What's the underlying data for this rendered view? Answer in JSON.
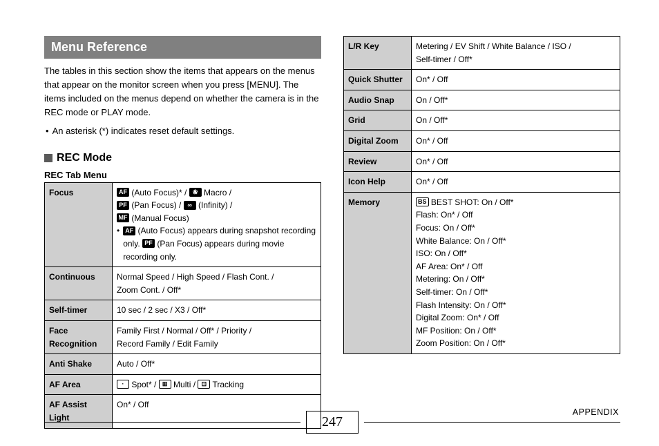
{
  "title": "Menu Reference",
  "intro": "The tables in this section show the items that appears on the menus that appear on the monitor screen when you press [MENU]. The items included on the menus depend on whether the camera is in the REC mode or PLAY mode.",
  "intro_bullet": "An asterisk (*) indicates reset default settings.",
  "rec_mode_heading": "REC Mode",
  "rec_tab_heading": "REC Tab Menu",
  "left_table": [
    {
      "key": "Focus",
      "lines": [
        {
          "parts": [
            {
              "t": "icon",
              "v": "AF"
            },
            {
              "t": "text",
              "v": " (Auto Focus)* / "
            },
            {
              "t": "icon",
              "v": "❀"
            },
            {
              "t": "text",
              "v": " Macro /"
            }
          ]
        },
        {
          "parts": [
            {
              "t": "icon",
              "v": "PF"
            },
            {
              "t": "text",
              "v": " (Pan Focus) / "
            },
            {
              "t": "icon",
              "v": "∞"
            },
            {
              "t": "text",
              "v": " (Infinity) /"
            }
          ]
        },
        {
          "parts": [
            {
              "t": "icon",
              "v": "MF"
            },
            {
              "t": "text",
              "v": " (Manual Focus)"
            }
          ]
        },
        {
          "sub": true,
          "parts": [
            {
              "t": "icon",
              "v": "AF"
            },
            {
              "t": "text",
              "v": " (Auto Focus) appears during snapshot recording only. "
            },
            {
              "t": "icon",
              "v": "PF"
            },
            {
              "t": "text",
              "v": " (Pan Focus) appears during movie recording only."
            }
          ]
        }
      ]
    },
    {
      "key": "Continuous",
      "lines": [
        {
          "parts": [
            {
              "t": "text",
              "v": "Normal Speed / High Speed / Flash Cont. /"
            }
          ]
        },
        {
          "parts": [
            {
              "t": "text",
              "v": "Zoom Cont. / Off*"
            }
          ]
        }
      ]
    },
    {
      "key": "Self-timer",
      "lines": [
        {
          "parts": [
            {
              "t": "text",
              "v": "10 sec / 2 sec / X3 / Off*"
            }
          ]
        }
      ]
    },
    {
      "key": "Face Recognition",
      "lines": [
        {
          "parts": [
            {
              "t": "text",
              "v": "Family First / Normal / Off* / Priority / "
            }
          ]
        },
        {
          "parts": [
            {
              "t": "text",
              "v": "Record Family / Edit Family"
            }
          ]
        }
      ]
    },
    {
      "key": "Anti Shake",
      "lines": [
        {
          "parts": [
            {
              "t": "text",
              "v": "Auto / Off*"
            }
          ]
        }
      ]
    },
    {
      "key": "AF Area",
      "lines": [
        {
          "parts": [
            {
              "t": "icon-outline",
              "v": "·"
            },
            {
              "t": "text",
              "v": " Spot* / "
            },
            {
              "t": "icon-outline",
              "v": "⊞"
            },
            {
              "t": "text",
              "v": " Multi / "
            },
            {
              "t": "icon-outline",
              "v": "⊡"
            },
            {
              "t": "text",
              "v": " Tracking"
            }
          ]
        }
      ]
    },
    {
      "key": "AF Assist Light",
      "lines": [
        {
          "parts": [
            {
              "t": "text",
              "v": "On* / Off"
            }
          ]
        }
      ]
    }
  ],
  "right_table": [
    {
      "key": "L/R Key",
      "lines": [
        {
          "parts": [
            {
              "t": "text",
              "v": "Metering / EV Shift / White Balance / ISO / "
            }
          ]
        },
        {
          "parts": [
            {
              "t": "text",
              "v": "Self-timer / Off*"
            }
          ]
        }
      ]
    },
    {
      "key": "Quick Shutter",
      "lines": [
        {
          "parts": [
            {
              "t": "text",
              "v": "On* / Off"
            }
          ]
        }
      ]
    },
    {
      "key": "Audio Snap",
      "lines": [
        {
          "parts": [
            {
              "t": "text",
              "v": "On / Off*"
            }
          ]
        }
      ]
    },
    {
      "key": "Grid",
      "lines": [
        {
          "parts": [
            {
              "t": "text",
              "v": "On / Off*"
            }
          ]
        }
      ]
    },
    {
      "key": "Digital Zoom",
      "lines": [
        {
          "parts": [
            {
              "t": "text",
              "v": "On* / Off"
            }
          ]
        }
      ]
    },
    {
      "key": "Review",
      "lines": [
        {
          "parts": [
            {
              "t": "text",
              "v": "On* / Off"
            }
          ]
        }
      ]
    },
    {
      "key": "Icon Help",
      "lines": [
        {
          "parts": [
            {
              "t": "text",
              "v": "On* / Off"
            }
          ]
        }
      ]
    },
    {
      "key": "Memory",
      "lines": [
        {
          "parts": [
            {
              "t": "icon-outline",
              "v": "BS"
            },
            {
              "t": "text",
              "v": " BEST SHOT: On / Off*"
            }
          ]
        },
        {
          "parts": [
            {
              "t": "text",
              "v": "Flash: On* / Off"
            }
          ]
        },
        {
          "parts": [
            {
              "t": "text",
              "v": "Focus: On / Off*"
            }
          ]
        },
        {
          "parts": [
            {
              "t": "text",
              "v": "White Balance: On / Off*"
            }
          ]
        },
        {
          "parts": [
            {
              "t": "text",
              "v": "ISO: On / Off*"
            }
          ]
        },
        {
          "parts": [
            {
              "t": "text",
              "v": "AF Area: On* / Off"
            }
          ]
        },
        {
          "parts": [
            {
              "t": "text",
              "v": "Metering: On / Off*"
            }
          ]
        },
        {
          "parts": [
            {
              "t": "text",
              "v": "Self-timer: On / Off*"
            }
          ]
        },
        {
          "parts": [
            {
              "t": "text",
              "v": "Flash Intensity: On / Off*"
            }
          ]
        },
        {
          "parts": [
            {
              "t": "text",
              "v": "Digital Zoom: On* / Off"
            }
          ]
        },
        {
          "parts": [
            {
              "t": "text",
              "v": "MF Position: On / Off*"
            }
          ]
        },
        {
          "parts": [
            {
              "t": "text",
              "v": "Zoom Position: On / Off*"
            }
          ]
        }
      ]
    }
  ],
  "page_number": "247",
  "appendix_label": "APPENDIX"
}
